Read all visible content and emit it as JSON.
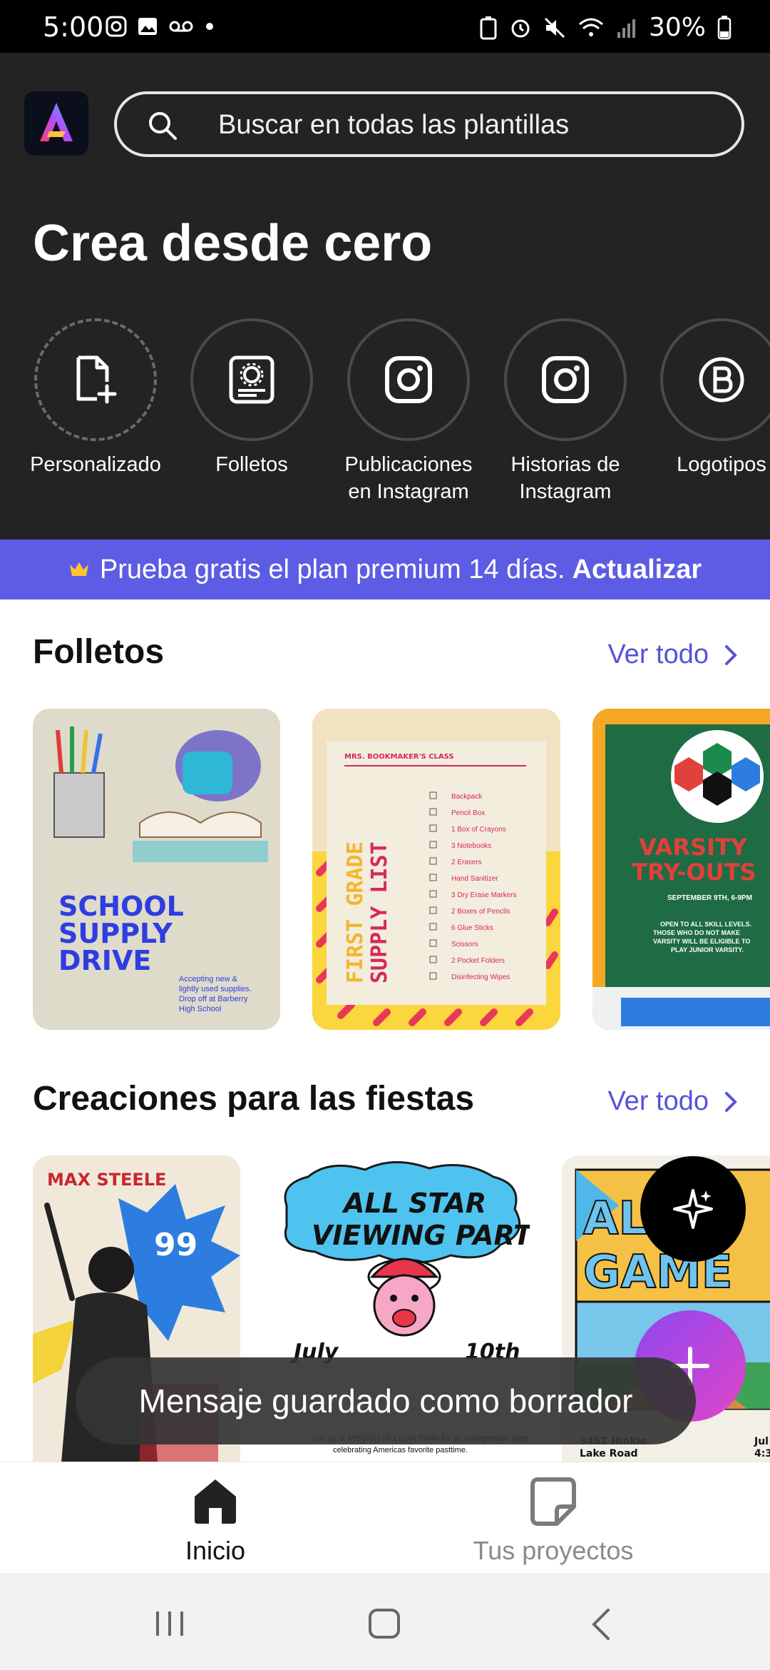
{
  "status_bar": {
    "time": "5:00",
    "battery": "30%"
  },
  "header": {
    "search_placeholder": "Buscar en todas las plantillas",
    "create_title": "Crea desde cero",
    "create_items": [
      {
        "label": "Personalizado",
        "icon": "file-plus-icon"
      },
      {
        "label": "Folletos",
        "icon": "flyer-icon"
      },
      {
        "label": "Publicaciones en Instagram",
        "icon": "instagram-icon"
      },
      {
        "label": "Historias de Instagram",
        "icon": "instagram-icon"
      },
      {
        "label": "Logotipos",
        "icon": "logo-b-icon"
      }
    ]
  },
  "promo": {
    "text": "Prueba gratis el plan premium 14 días.",
    "action": "Actualizar"
  },
  "sections": [
    {
      "title": "Folletos",
      "see_all": "Ver todo",
      "cards": [
        {
          "title": "SCHOOL SUPPLY DRIVE",
          "caption": "Accepting new & lightly used supplies. Drop off at Barberry High School"
        },
        {
          "header": "MRS. BOOKMAKER'S CLASS",
          "side_title": "FIRST GRADE SUPPLY LIST",
          "items": [
            "Backpack",
            "Pencil Box",
            "1 Box of Crayons",
            "3 Notebooks",
            "2 Erasers",
            "Hand Sanitizer",
            "3 Dry Erase Markers",
            "2 Boxes of Pencils",
            "6 Glue Sticks",
            "Scissors",
            "2 Pocket Folders",
            "Disinfecting Wipes"
          ]
        },
        {
          "title": "VARSITY TRY-OUTS",
          "date": "SEPTEMBER 9TH, 6-9PM",
          "caption": "OPEN TO ALL SKILL LEVELS. THOSE WHO DO NOT MAKE VARSITY WILL BE ELIGIBLE TO PLAY JUNIOR VARSITY."
        }
      ]
    },
    {
      "title": "Creaciones para las fiestas",
      "see_all": "Ver todo",
      "cards": [
        {
          "name": "MAX STEELE",
          "number": "99"
        },
        {
          "title": "ALL STAR VIEWING PARTY",
          "month": "July",
          "day": "10th",
          "caption": "Join us at MISSION HOLLOW PARK for an unforgettable night celebrating Americas favorite pasttime."
        },
        {
          "title": "ALL STAR GAME",
          "address": "3452 Hinkle Lake Road",
          "month": "Jul",
          "year_fragment": "4:3"
        }
      ]
    }
  ],
  "toast": "Mensaje guardado como borrador",
  "bottom_nav": [
    {
      "label": "Inicio",
      "icon": "home-icon",
      "active": true
    },
    {
      "label": "Tus proyectos",
      "icon": "projects-icon",
      "active": false
    }
  ],
  "colors": {
    "dark_bg": "#232323",
    "promo_bg": "#5d5ce4",
    "accent": "#5653d6"
  }
}
